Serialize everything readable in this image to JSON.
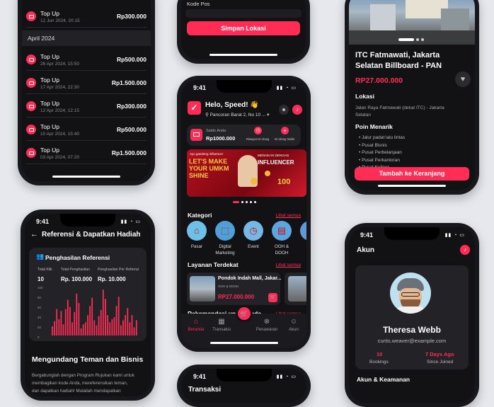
{
  "history": {
    "top_row": {
      "title": "Top Up",
      "date": "12 Jun 2024, 20:15",
      "amount": "Rp300.000"
    },
    "month": "April 2024",
    "rows": [
      {
        "title": "Top Up",
        "date": "26 Apr 2024, 15:50",
        "amount": "Rp500.000"
      },
      {
        "title": "Top Up",
        "date": "17 Apr 2024, 22:30",
        "amount": "Rp1.500.000"
      },
      {
        "title": "Top Up",
        "date": "12 Apr 2024, 12:15",
        "amount": "Rp300.000"
      },
      {
        "title": "Top Up",
        "date": "10 Apr 2024, 15:40",
        "amount": "Rp500.000"
      },
      {
        "title": "Top Up",
        "date": "03 Apr 2024, 07:20",
        "amount": "Rp1.500.000"
      }
    ]
  },
  "form": {
    "label": "Kode Pos",
    "save_button": "Simpan Lokasi"
  },
  "detail": {
    "title": "ITC Fatmawati, Jakarta Selatan Billboard - PAN",
    "price": "RP27.000.000",
    "location_heading": "Lokasi",
    "address": "Jalan Raya Fatmawati (dekat ITC) - Jakarta Selatan",
    "points_heading": "Poin Menarik",
    "points": [
      "Jalur padat lalu lintas",
      "Pusat Bisnis",
      "Pusat Perbelanjaan",
      "Pusat Perkantoran",
      "Pusat Kuliner"
    ],
    "cart_button": "Tambah ke Keranjang"
  },
  "home": {
    "time": "9:41",
    "greeting": "Helo, Speed! 👋",
    "location": "Pancoran Barat 2, No 10 ...",
    "balance_label": "Saldo Anda",
    "balance": "Rp1000.000",
    "history_label": "Riwayat Isi Ulang",
    "topup_label": "Isi Ulang Saldo",
    "banner": {
      "line1": "Ayo gandeng influencer",
      "line2": "LET'S MAKE YOUR UMKM SHINE",
      "right1": "MENAIKAN DENGAN",
      "right2": "INFLUENCER",
      "right3": "100"
    },
    "category_heading": "Kategori",
    "see_all": "Lihat semua",
    "categories": [
      "Pasar",
      "Digital Marketing",
      "Event",
      "OOH & DOOH"
    ],
    "nearby_heading": "Layanan Terdekat",
    "nearby": {
      "title": "Pondok Indah Mall, Jakar...",
      "tag": "OOH & DOOH",
      "price": "RP27.000.000"
    },
    "reco_heading": "Rekomendasi untuk Anda",
    "nav": [
      "Beranda",
      "Transaksi",
      "",
      "Penawaran",
      "Akun"
    ]
  },
  "referral": {
    "time": "9:41",
    "title": "Referensi & Dapatkan Hadiah",
    "card_title": "Penghasilan Referensi",
    "stats": [
      {
        "label": "Total Klik",
        "value": "10"
      },
      {
        "label": "Total Penghasilan",
        "value": "Rp. 100.000"
      },
      {
        "label": "Penghasilan Per Referral",
        "value": "Rp. 10.000"
      }
    ],
    "y_ticks": [
      "100",
      "80",
      "60",
      "40",
      "20",
      "0"
    ],
    "bars": [
      18,
      28,
      52,
      32,
      48,
      22,
      52,
      70,
      56,
      26,
      46,
      82,
      64,
      14,
      22,
      26,
      40,
      58,
      74,
      30,
      20,
      38,
      50,
      90,
      72,
      40,
      26,
      32,
      36,
      58,
      76,
      20,
      30,
      40,
      54,
      26,
      40,
      16,
      30
    ],
    "headline": "Mengundang Teman dan Bisnis",
    "body1": "Bergabunglah dengan Program Rujukan kami untuk",
    "body2": "membagikan kode Anda, mereferensikan teman,",
    "body3": "dan dapatkan hadiah! Mulailah mendapatkan"
  },
  "account": {
    "time": "9:41",
    "title": "Akun",
    "name": "Theresa Webb",
    "email": "curtis.weaver@example.com",
    "bookings_value": "10",
    "bookings_label": "Bookings",
    "since_value": "7 Days Ago",
    "since_label": "Since Joined",
    "section": "Akun & Keamanan"
  },
  "bottom": {
    "time": "9:41",
    "title": "Transaksi"
  },
  "colors": {
    "accent": "#ff2d55",
    "bg": "#121214",
    "card": "#222227"
  }
}
